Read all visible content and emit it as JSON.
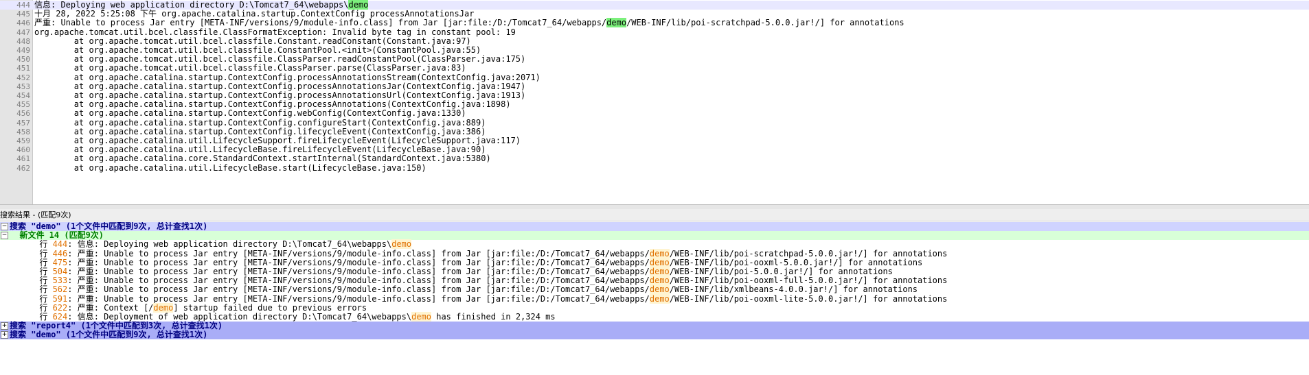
{
  "editor": {
    "lines": [
      {
        "n": "444",
        "parts": [
          {
            "t": "信息: Deploying web application directory D:\\Tomcat7_64\\webapps\\"
          },
          {
            "t": "demo",
            "hl": "g"
          }
        ]
      },
      {
        "n": "445",
        "parts": [
          {
            "t": "十月 28, 2022 5:25:08 下午 org.apache.catalina.startup.ContextConfig processAnnotationsJar"
          }
        ]
      },
      {
        "n": "446",
        "parts": [
          {
            "t": "严重: Unable to process Jar entry [META-INF/versions/9/module-info.class] from Jar [jar:file:/D:/Tomcat7_64/webapps/"
          },
          {
            "t": "demo",
            "hl": "g"
          },
          {
            "t": "/WEB-INF/lib/poi-scratchpad-5.0.0.jar!/] for annotations"
          }
        ]
      },
      {
        "n": "447",
        "parts": [
          {
            "t": "org.apache.tomcat.util.bcel.classfile.ClassFormatException: Invalid byte tag in constant pool: 19"
          }
        ]
      },
      {
        "n": "448",
        "parts": [
          {
            "t": "        at org.apache.tomcat.util.bcel.classfile.Constant.readConstant(Constant.java:97)"
          }
        ]
      },
      {
        "n": "449",
        "parts": [
          {
            "t": "        at org.apache.tomcat.util.bcel.classfile.ConstantPool.<init>(ConstantPool.java:55)"
          }
        ]
      },
      {
        "n": "450",
        "parts": [
          {
            "t": "        at org.apache.tomcat.util.bcel.classfile.ClassParser.readConstantPool(ClassParser.java:175)"
          }
        ]
      },
      {
        "n": "451",
        "parts": [
          {
            "t": "        at org.apache.tomcat.util.bcel.classfile.ClassParser.parse(ClassParser.java:83)"
          }
        ]
      },
      {
        "n": "452",
        "parts": [
          {
            "t": "        at org.apache.catalina.startup.ContextConfig.processAnnotationsStream(ContextConfig.java:2071)"
          }
        ]
      },
      {
        "n": "453",
        "parts": [
          {
            "t": "        at org.apache.catalina.startup.ContextConfig.processAnnotationsJar(ContextConfig.java:1947)"
          }
        ]
      },
      {
        "n": "454",
        "parts": [
          {
            "t": "        at org.apache.catalina.startup.ContextConfig.processAnnotationsUrl(ContextConfig.java:1913)"
          }
        ]
      },
      {
        "n": "455",
        "parts": [
          {
            "t": "        at org.apache.catalina.startup.ContextConfig.processAnnotations(ContextConfig.java:1898)"
          }
        ]
      },
      {
        "n": "456",
        "parts": [
          {
            "t": "        at org.apache.catalina.startup.ContextConfig.webConfig(ContextConfig.java:1330)"
          }
        ]
      },
      {
        "n": "457",
        "parts": [
          {
            "t": "        at org.apache.catalina.startup.ContextConfig.configureStart(ContextConfig.java:889)"
          }
        ]
      },
      {
        "n": "458",
        "parts": [
          {
            "t": "        at org.apache.catalina.startup.ContextConfig.lifecycleEvent(ContextConfig.java:386)"
          }
        ]
      },
      {
        "n": "459",
        "parts": [
          {
            "t": "        at org.apache.catalina.util.LifecycleSupport.fireLifecycleEvent(LifecycleSupport.java:117)"
          }
        ]
      },
      {
        "n": "460",
        "parts": [
          {
            "t": "        at org.apache.catalina.util.LifecycleBase.fireLifecycleEvent(LifecycleBase.java:90)"
          }
        ]
      },
      {
        "n": "461",
        "parts": [
          {
            "t": "        at org.apache.catalina.core.StandardContext.startInternal(StandardContext.java:5380)"
          }
        ]
      },
      {
        "n": "462",
        "parts": [
          {
            "t": "        at org.apache.catalina.util.LifecycleBase.start(LifecycleBase.java:150)"
          }
        ]
      }
    ]
  },
  "results_panel": {
    "title": "搜索结果 - (匹配9次)",
    "rows": [
      {
        "kind": "search",
        "exp": "−",
        "parts": [
          {
            "t": "搜索 \"demo\" (1个文件中匹配到9次, 总计查找1次)"
          }
        ]
      },
      {
        "kind": "file",
        "exp": "−",
        "parts": [
          {
            "t": "  新文件 14 (匹配9次)"
          }
        ]
      },
      {
        "kind": "hit",
        "parts": [
          {
            "t": "      行 "
          },
          {
            "t": "444",
            "c": "num"
          },
          {
            "t": ": 信息: Deploying web application directory D:\\Tomcat7_64\\webapps\\"
          },
          {
            "t": "demo",
            "hl": "o"
          }
        ]
      },
      {
        "kind": "hit",
        "parts": [
          {
            "t": "      行 "
          },
          {
            "t": "446",
            "c": "num"
          },
          {
            "t": ": 严重: Unable to process Jar entry [META-INF/versions/9/module-info.class] from Jar [jar:file:/D:/Tomcat7_64/webapps/"
          },
          {
            "t": "demo",
            "hl": "o"
          },
          {
            "t": "/WEB-INF/lib/poi-scratchpad-5.0.0.jar!/] for annotations"
          }
        ]
      },
      {
        "kind": "hit",
        "parts": [
          {
            "t": "      行 "
          },
          {
            "t": "475",
            "c": "num"
          },
          {
            "t": ": 严重: Unable to process Jar entry [META-INF/versions/9/module-info.class] from Jar [jar:file:/D:/Tomcat7_64/webapps/"
          },
          {
            "t": "demo",
            "hl": "o"
          },
          {
            "t": "/WEB-INF/lib/poi-ooxml-5.0.0.jar!/] for annotations"
          }
        ]
      },
      {
        "kind": "hit",
        "parts": [
          {
            "t": "      行 "
          },
          {
            "t": "504",
            "c": "num"
          },
          {
            "t": ": 严重: Unable to process Jar entry [META-INF/versions/9/module-info.class] from Jar [jar:file:/D:/Tomcat7_64/webapps/"
          },
          {
            "t": "demo",
            "hl": "o"
          },
          {
            "t": "/WEB-INF/lib/poi-5.0.0.jar!/] for annotations"
          }
        ]
      },
      {
        "kind": "hit",
        "parts": [
          {
            "t": "      行 "
          },
          {
            "t": "533",
            "c": "num"
          },
          {
            "t": ": 严重: Unable to process Jar entry [META-INF/versions/9/module-info.class] from Jar [jar:file:/D:/Tomcat7_64/webapps/"
          },
          {
            "t": "demo",
            "hl": "o"
          },
          {
            "t": "/WEB-INF/lib/poi-ooxml-full-5.0.0.jar!/] for annotations"
          }
        ]
      },
      {
        "kind": "hit",
        "parts": [
          {
            "t": "      行 "
          },
          {
            "t": "562",
            "c": "num"
          },
          {
            "t": ": 严重: Unable to process Jar entry [META-INF/versions/9/module-info.class] from Jar [jar:file:/D:/Tomcat7_64/webapps/"
          },
          {
            "t": "demo",
            "hl": "o"
          },
          {
            "t": "/WEB-INF/lib/xmlbeans-4.0.0.jar!/] for annotations"
          }
        ]
      },
      {
        "kind": "hit",
        "parts": [
          {
            "t": "      行 "
          },
          {
            "t": "591",
            "c": "num"
          },
          {
            "t": ": 严重: Unable to process Jar entry [META-INF/versions/9/module-info.class] from Jar [jar:file:/D:/Tomcat7_64/webapps/"
          },
          {
            "t": "demo",
            "hl": "o"
          },
          {
            "t": "/WEB-INF/lib/poi-ooxml-lite-5.0.0.jar!/] for annotations"
          }
        ]
      },
      {
        "kind": "hit",
        "parts": [
          {
            "t": "      行 "
          },
          {
            "t": "622",
            "c": "num"
          },
          {
            "t": ": 严重: Context [/"
          },
          {
            "t": "demo",
            "hl": "o"
          },
          {
            "t": "] startup failed due to previous errors"
          }
        ]
      },
      {
        "kind": "hit",
        "parts": [
          {
            "t": "      行 "
          },
          {
            "t": "624",
            "c": "num"
          },
          {
            "t": ": 信息: Deployment of web application directory D:\\Tomcat7_64\\webapps\\"
          },
          {
            "t": "demo",
            "hl": "o"
          },
          {
            "t": " has finished in 2,324 ms"
          }
        ]
      },
      {
        "kind": "search2",
        "exp": "+",
        "parts": [
          {
            "t": "搜索 \"report4\" (1个文件中匹配到3次, 总计查找1次)"
          }
        ]
      },
      {
        "kind": "search2",
        "exp": "+",
        "parts": [
          {
            "t": "搜索 \"demo\" (1个文件中匹配到9次, 总计查找1次)"
          }
        ]
      }
    ]
  }
}
